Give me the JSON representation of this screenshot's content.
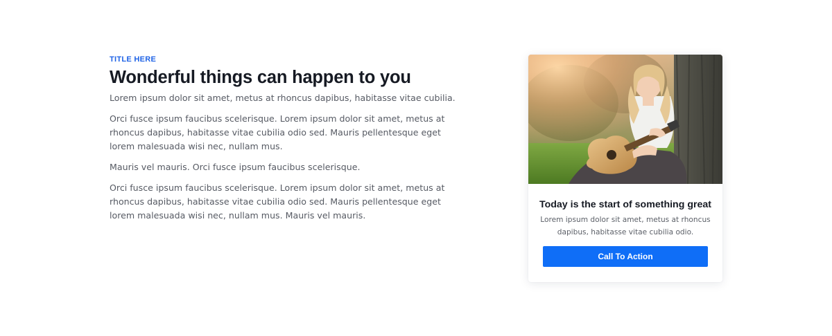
{
  "content": {
    "eyebrow": "TITLE HERE",
    "headline": "Wonderful things can happen to you",
    "paragraphs": [
      "Lorem ipsum dolor sit amet, metus at rhoncus dapibus, habitasse vitae cubilia.",
      "Orci fusce ipsum faucibus scelerisque. Lorem ipsum dolor sit amet, metus at rhoncus dapibus, habitasse vitae cubilia odio sed. Mauris pellentesque eget lorem malesuada wisi nec, nullam mus.",
      "Mauris vel mauris. Orci fusce ipsum faucibus scelerisque.",
      "Orci fusce ipsum faucibus scelerisque. Lorem ipsum dolor sit amet, metus at rhoncus dapibus, habitasse vitae cubilia odio sed. Mauris pellentesque eget lorem malesuada wisi nec, nullam mus. Mauris vel mauris."
    ]
  },
  "card": {
    "image_icon": "photo-woman-playing-guitar",
    "title": "Today is the start of something great",
    "text": "Lorem ipsum dolor sit amet, metus at rhoncus dapibus, habitasse vitae cubilia odio.",
    "cta_label": "Call To Action"
  },
  "colors": {
    "accent": "#1f63e6",
    "button": "#0f6ef7",
    "heading": "#161a23",
    "body_text": "#565a63"
  }
}
